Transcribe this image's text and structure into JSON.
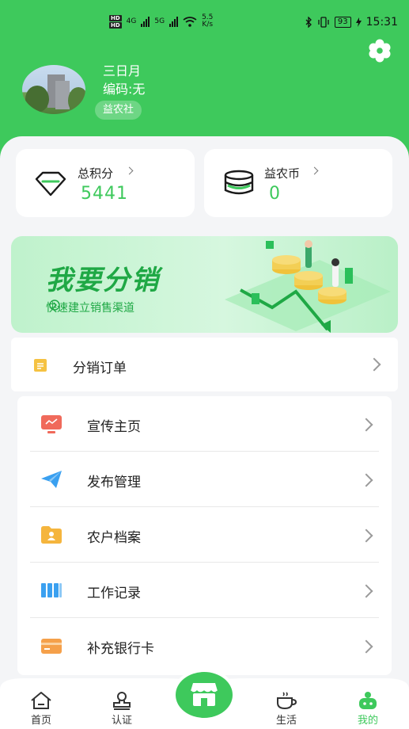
{
  "status_bar": {
    "hd1": "HD",
    "hd2": "HD",
    "net1": "4G",
    "net2": "5G",
    "speed_value": "5.5",
    "speed_unit": "K/s",
    "battery": "93",
    "time": "15:31"
  },
  "profile": {
    "name": "三日月",
    "code": "编码:无",
    "tag": "益农社"
  },
  "stats": {
    "points_label": "总积分",
    "points_value": "5441",
    "coins_label": "益农币",
    "coins_value": "0"
  },
  "banner": {
    "title": "我要分销",
    "subtitle": "快速建立销售渠道"
  },
  "orders": {
    "label": "分销订单"
  },
  "menu": [
    {
      "label": "宣传主页",
      "icon": "monitor-icon",
      "color": "#f06a5b"
    },
    {
      "label": "发布管理",
      "icon": "paper-plane-icon",
      "color": "#3aa0f0"
    },
    {
      "label": "农户档案",
      "icon": "folder-user-icon",
      "color": "#f5b53d"
    },
    {
      "label": "工作记录",
      "icon": "books-icon",
      "color": "#3aa0f0"
    },
    {
      "label": "补充银行卡",
      "icon": "bank-card-icon",
      "color": "#f5a04a"
    }
  ],
  "tabbar": {
    "home": "首页",
    "certify": "认证",
    "life": "生活",
    "mine": "我的"
  },
  "colors": {
    "brand": "#3ec95c",
    "background": "#f4f5f7"
  }
}
